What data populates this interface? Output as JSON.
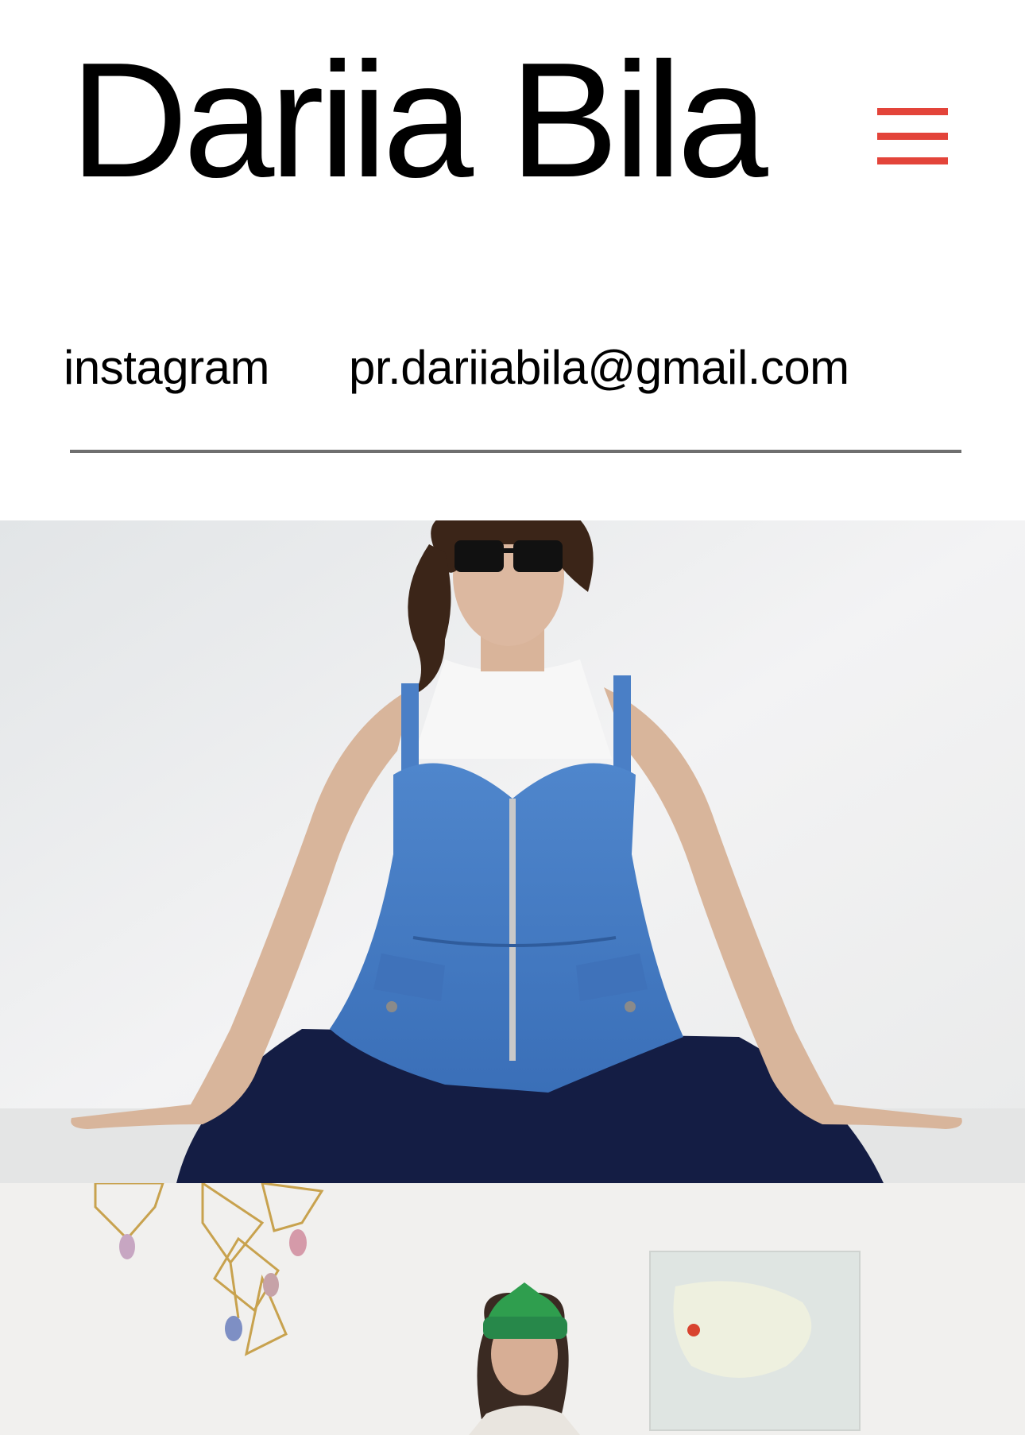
{
  "header": {
    "title": "Dariia Bila",
    "menu_icon": "hamburger-menu-icon",
    "accent_color": "#e3443a"
  },
  "contact": {
    "instagram_label": "instagram",
    "email_label": "pr.dariiabila@gmail.com"
  },
  "gallery": {
    "photos": [
      {
        "subject": "woman-in-denim-corset-top"
      },
      {
        "subject": "woman-in-green-knit-hat"
      }
    ]
  }
}
